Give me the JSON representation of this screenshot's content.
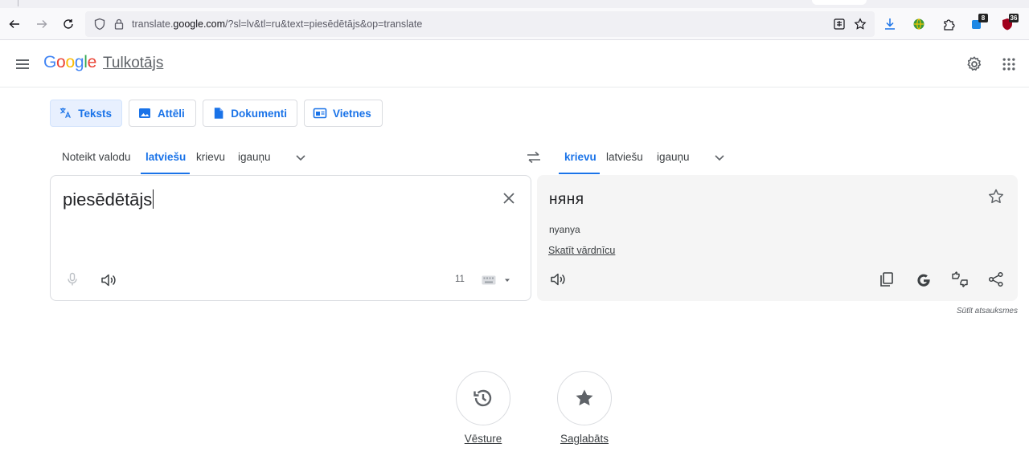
{
  "browser": {
    "url_prefix": "translate.",
    "url_domain": "google.com",
    "url_path": "/?sl=lv&tl=ru&text=piesēdētājs&op=translate",
    "badges": {
      "extension_1": "8",
      "extension_2": "36"
    }
  },
  "header": {
    "logo_letters": [
      "G",
      "o",
      "o",
      "g",
      "l",
      "e"
    ],
    "logo_colors": [
      "#4285f4",
      "#ea4335",
      "#fbbc05",
      "#4285f4",
      "#34a853",
      "#ea4335"
    ],
    "product_name": "Tulkotājs"
  },
  "modes": [
    {
      "label": "Teksts",
      "icon": "translate-icon",
      "active": true
    },
    {
      "label": "Attēli",
      "icon": "image-icon",
      "active": false
    },
    {
      "label": "Dokumenti",
      "icon": "document-icon",
      "active": false
    },
    {
      "label": "Vietnes",
      "icon": "website-icon",
      "active": false
    }
  ],
  "source_languages": {
    "detect": "Noteikt valodu",
    "items": [
      "latviešu",
      "krievu",
      "igauņu"
    ],
    "selected": "latviešu"
  },
  "target_languages": {
    "items": [
      "krievu",
      "latviešu",
      "igauņu"
    ],
    "selected": "krievu"
  },
  "source": {
    "text": "piesēdētājs",
    "char_count": "11"
  },
  "target": {
    "text": "няня",
    "transliteration": "nyanya",
    "dictionary_link": "Skatīt vārdnīcu"
  },
  "feedback": "Sūtīt atsauksmes",
  "bottom": {
    "history": "Vēsture",
    "saved": "Saglabāts"
  },
  "colors": {
    "accent": "#1a73e8",
    "accent_bg": "#e8f0fe",
    "icon_grey": "#5f6368"
  }
}
